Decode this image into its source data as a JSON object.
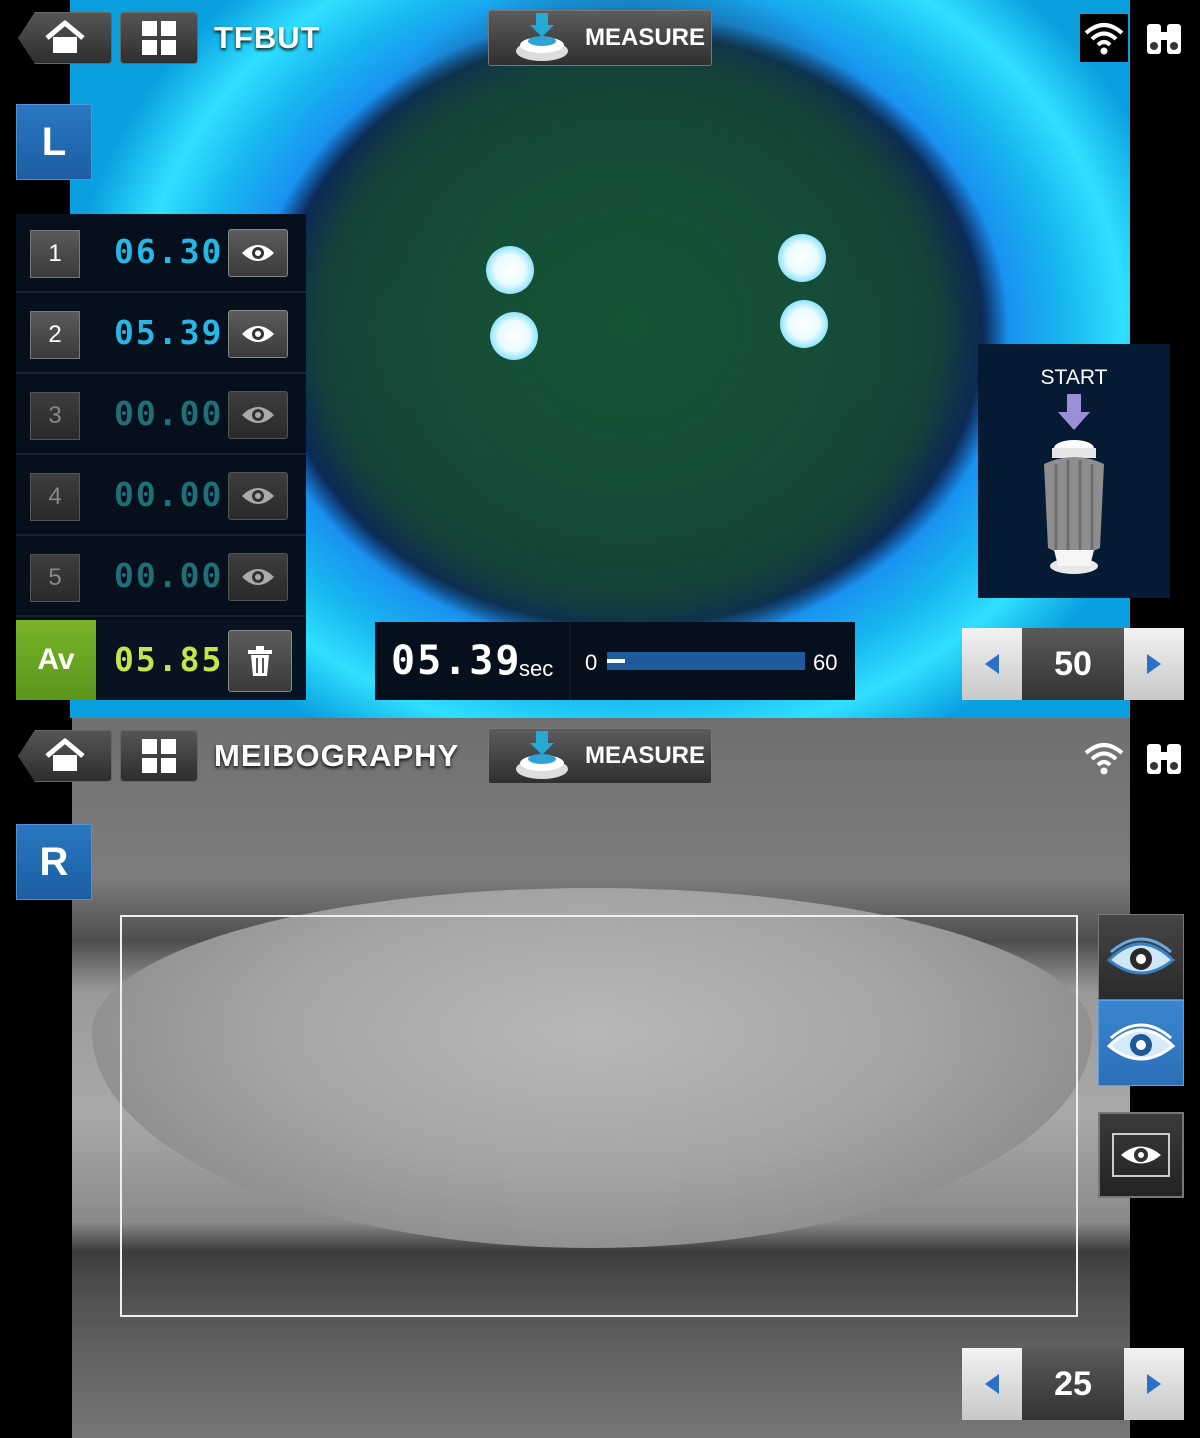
{
  "top": {
    "title": "TFBUT",
    "measure_label": "MEASURE",
    "eye_side": "L",
    "results": [
      {
        "index": "1",
        "value": "06.30"
      },
      {
        "index": "2",
        "value": "05.39"
      },
      {
        "index": "3",
        "value": "00.00"
      },
      {
        "index": "4",
        "value": "00.00"
      },
      {
        "index": "5",
        "value": "00.00"
      }
    ],
    "average": {
      "label": "Av",
      "value": "05.85"
    },
    "timer": {
      "time": "05.39",
      "unit": "sec",
      "min": "0",
      "max": "60",
      "progress_fraction": 0.09
    },
    "start_label": "START",
    "stepper_value": "50"
  },
  "bottom": {
    "title": "MEIBOGRAPHY",
    "measure_label": "MEASURE",
    "eye_side": "R",
    "stepper_value": "25"
  },
  "colors": {
    "side_badge": "#1c5ea3",
    "result_value": "#27b7e6",
    "average_badge": "#6aa522",
    "average_value": "#c6e54a",
    "timer_track": "#1f5a9a"
  }
}
